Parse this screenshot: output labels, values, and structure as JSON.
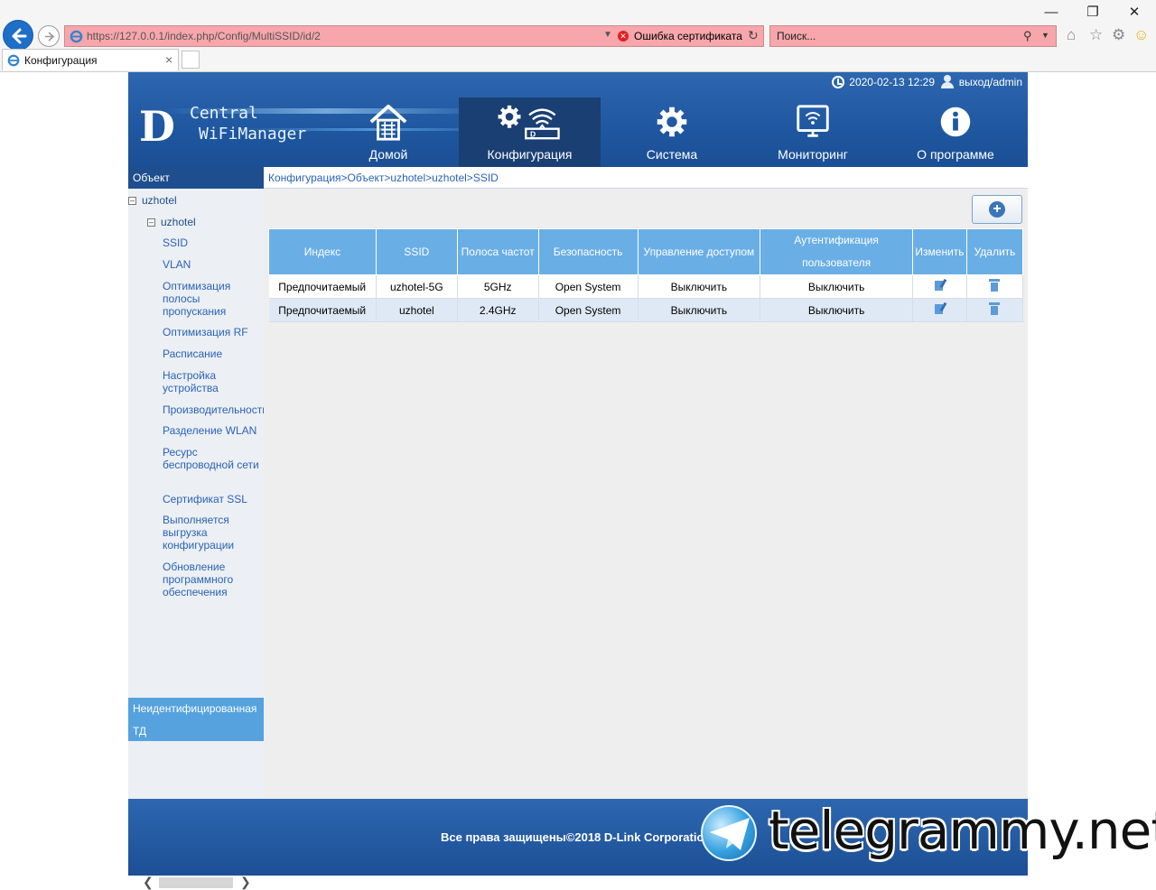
{
  "browser": {
    "url": "https://127.0.0.1/index.php/Config/MultiSSID/id/2",
    "cert_error": "Ошибка сертификата",
    "search_placeholder": "Поиск...",
    "tab_title": "Конфигурация"
  },
  "header": {
    "logo_letter": "D",
    "logo_line1": "Central",
    "logo_line2": "WiFiManager",
    "datetime": "2020-02-13 12:29",
    "logout": "выход/admin",
    "menu": [
      {
        "label": "Домой",
        "icon": "home-icon"
      },
      {
        "label": "Конфигурация",
        "icon": "config-icon",
        "active": true
      },
      {
        "label": "Система",
        "icon": "gear-icon"
      },
      {
        "label": "Мониторинг",
        "icon": "monitor-icon"
      },
      {
        "label": "О программе",
        "icon": "info-icon"
      }
    ]
  },
  "sidebar": {
    "header": "Объект",
    "root": "uzhotel",
    "child": "uzhotel",
    "links": [
      "SSID",
      "VLAN",
      "Оптимизация полосы пропускания",
      "Оптимизация RF",
      "Расписание",
      "Настройка устройства",
      "Производительность",
      "Разделение WLAN",
      "Ресурс беспроводной сети",
      "Сертификат SSL",
      "Выполняется выгрузка конфигурации",
      "Обновление программного обеспечения"
    ],
    "unidentified_line1": "Неидентифицированная",
    "unidentified_line2": "ТД"
  },
  "breadcrumb": "Конфигурация>Объект>uzhotel>uzhotel>SSID",
  "table": {
    "headers": [
      "Индекс",
      "SSID",
      "Полоса частот",
      "Безопасность",
      "Управление доступом",
      "Аутентификация пользователя",
      "Изменить",
      "Удалить"
    ],
    "rows": [
      [
        "Предпочитаемый",
        "uzhotel-5G",
        "5GHz",
        "Open System",
        "Выключить",
        "Выключить"
      ],
      [
        "Предпочитаемый",
        "uzhotel",
        "2.4GHz",
        "Open System",
        "Выключить",
        "Выключить"
      ]
    ]
  },
  "footer": {
    "copyright": "Все права защищены©2018 D-Link Corporation"
  },
  "watermark": "telegrammy.net",
  "colors": {
    "header_blue": "#2d67b0",
    "active_menu": "#1a3f73",
    "table_header": "#6aaee6",
    "link_blue": "#2a63b8",
    "address_error": "#f7a6ab"
  }
}
